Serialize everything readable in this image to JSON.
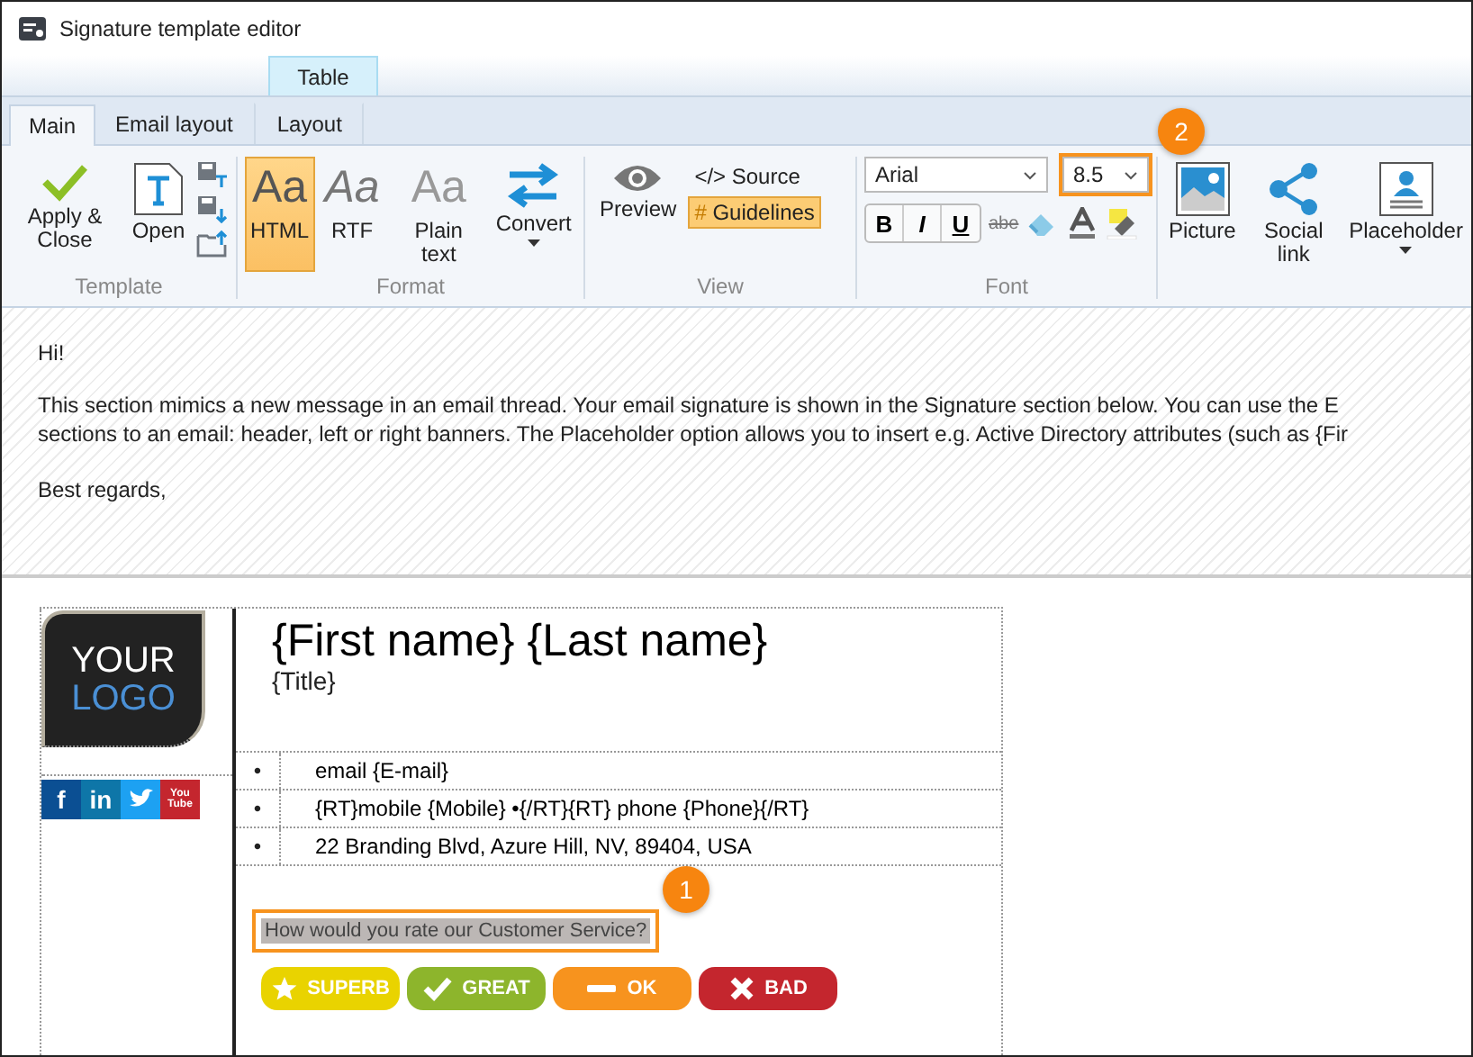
{
  "window": {
    "title": "Signature template editor"
  },
  "contextual_tab": {
    "label": "Table"
  },
  "tabs": [
    {
      "label": "Main",
      "selected": true
    },
    {
      "label": "Email layout",
      "selected": false
    },
    {
      "label": "Layout",
      "selected": false
    }
  ],
  "ribbon": {
    "template": {
      "label": "Template",
      "buttons": [
        {
          "label": "Apply & Close",
          "kind": "apply"
        },
        {
          "label": "Open",
          "kind": "open"
        }
      ]
    },
    "format": {
      "label": "Format",
      "buttons": [
        {
          "label": "HTML",
          "glyph": "Aa",
          "kind": "html",
          "selected": true
        },
        {
          "label": "RTF",
          "glyph": "Aa",
          "kind": "rtf",
          "selected": false
        },
        {
          "label": "Plain text",
          "glyph": "Aa",
          "kind": "plain",
          "selected": false
        },
        {
          "label": "Convert",
          "kind": "convert",
          "selected": false
        }
      ]
    },
    "view": {
      "label": "View",
      "preview": "Preview",
      "source": {
        "glyph": "</>",
        "label": "Source"
      },
      "guidelines": {
        "glyph": "#",
        "label": "Guidelines",
        "on": true
      }
    },
    "font": {
      "label": "Font",
      "family": "Arial",
      "size": "8.5",
      "size_highlighted": true,
      "styles": [
        {
          "label": "B",
          "kind": "bold"
        },
        {
          "label": "I",
          "kind": "italic"
        },
        {
          "label": "U",
          "kind": "underline"
        }
      ],
      "strike": "abe"
    },
    "insert": {
      "buttons": [
        {
          "label": "Picture",
          "kind": "picture"
        },
        {
          "label": "Social link",
          "kind": "social"
        },
        {
          "label": "Placeholder",
          "kind": "placeholder"
        }
      ]
    }
  },
  "callouts": [
    {
      "number": "1"
    },
    {
      "number": "2"
    }
  ],
  "email": {
    "greeting": "Hi!",
    "body_lines": [
      "This section mimics a new message in an email thread. Your email signature is shown in the Signature section below. You can use the E",
      "sections to an email: header, left or right banners. The Placeholder option allows you to insert e.g. Active Directory attributes (such as {Fir"
    ],
    "closing": "Best regards,"
  },
  "signature": {
    "logo": {
      "top": "YOUR",
      "bottom": "LOGO"
    },
    "social_icons": [
      {
        "kind": "letter",
        "text": "f",
        "color": "#0b4f93"
      },
      {
        "kind": "letter",
        "text": "in",
        "color": "#0e76a8"
      },
      {
        "kind": "bird",
        "color": "#1da1f2"
      },
      {
        "kind": "video",
        "text": "You Tube",
        "color": "#c4262e"
      }
    ],
    "name": "{First name} {Last name}",
    "title": "{Title}",
    "contacts": [
      {
        "bullet": "•",
        "text": "email {E-mail}"
      },
      {
        "bullet": "•",
        "text": "{RT}mobile {Mobile} •{/RT}{RT} phone {Phone}{/RT}"
      },
      {
        "bullet": "•",
        "text": "22 Branding Blvd, Azure Hill, NV, 89404, USA"
      }
    ],
    "question": {
      "text": "How would you rate our Customer Service?",
      "highlighted": true
    },
    "ratings": [
      {
        "label": "SUPERB",
        "kind": "star",
        "color": "#e9d300"
      },
      {
        "label": "GREAT",
        "kind": "check",
        "color": "#8db52c"
      },
      {
        "label": "OK",
        "kind": "dash",
        "color": "#f7931e"
      },
      {
        "label": "BAD",
        "kind": "cross",
        "color": "#c4262e"
      }
    ]
  }
}
